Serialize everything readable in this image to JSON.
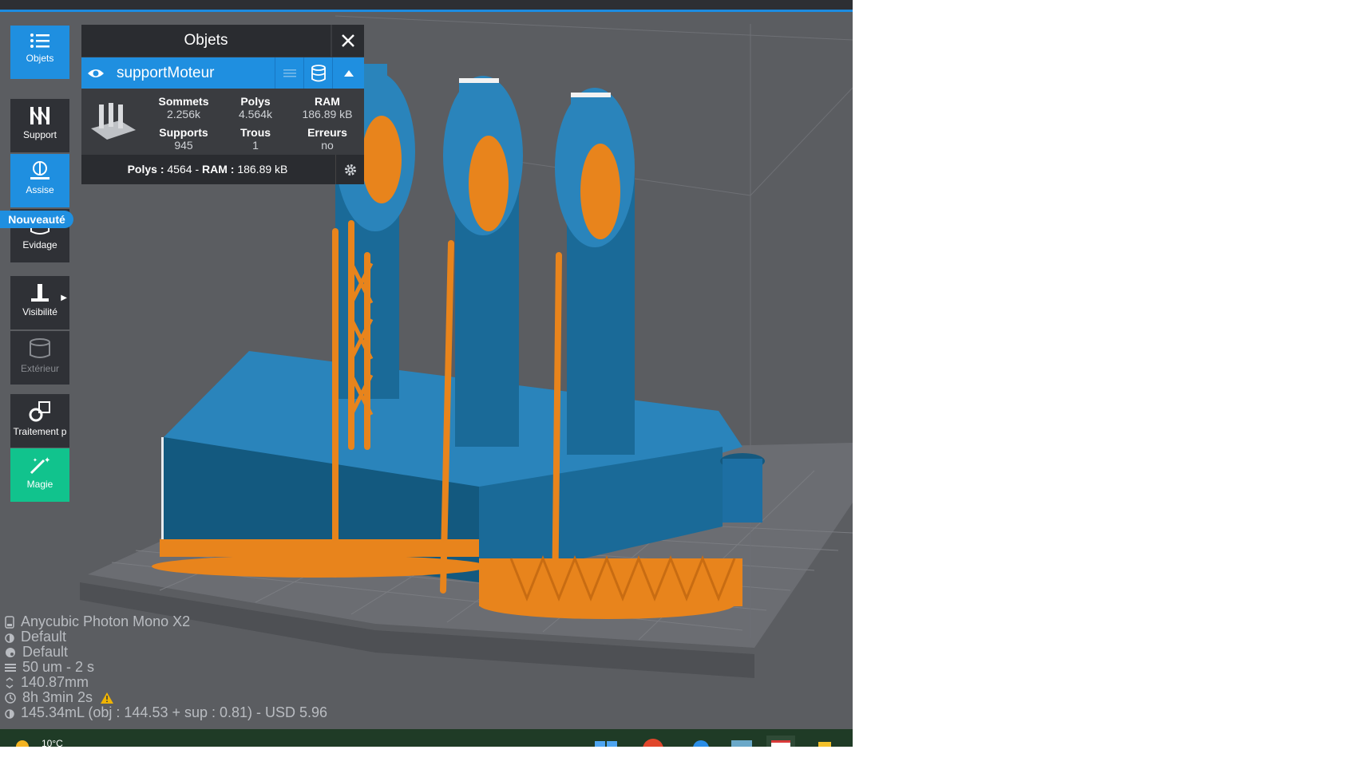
{
  "sidebar": {
    "items": [
      {
        "label": "Objets",
        "icon": "list-icon"
      },
      {
        "label": "Support",
        "icon": "support-icon"
      },
      {
        "label": "Assise",
        "icon": "seat-icon"
      },
      {
        "label": "Evidage",
        "icon": "hollow-icon"
      },
      {
        "label": "Visibilité",
        "icon": "visibility-icon"
      },
      {
        "label": "Extérieur",
        "icon": "cylinder-icon"
      },
      {
        "label": "Traitement p",
        "icon": "processing-icon"
      },
      {
        "label": "Magie",
        "icon": "magic-wand-icon"
      }
    ],
    "badge": "Nouveauté"
  },
  "panel": {
    "title": "Objets",
    "object_name": "supportMoteur",
    "stats": {
      "vertices_label": "Sommets",
      "vertices_value": "2.256k",
      "polys_label": "Polys",
      "polys_value": "4.564k",
      "ram_label": "RAM",
      "ram_value": "186.89 kB",
      "supports_label": "Supports",
      "supports_value": "945",
      "holes_label": "Trous",
      "holes_value": "1",
      "errors_label": "Erreurs",
      "errors_value": "no"
    },
    "footer": {
      "polys_label": "Polys :",
      "polys_value": "4564",
      "sep": "-",
      "ram_label": "RAM :",
      "ram_value": "186.89 kB"
    }
  },
  "info": {
    "printer": "Anycubic Photon Mono X2",
    "resin": "Default",
    "profile": "Default",
    "layer": "50 um - 2 s",
    "height": "140.87mm",
    "time": "8h 3min 2s",
    "volume": "145.34mL (obj : 144.53 + sup : 0.81) - USD 5.96"
  },
  "taskbar": {
    "temperature": "10°C"
  },
  "colors": {
    "accent": "#1f8fe0",
    "model": "#1d6fa3",
    "supports": "#e8841c",
    "magic": "#11c38d"
  }
}
